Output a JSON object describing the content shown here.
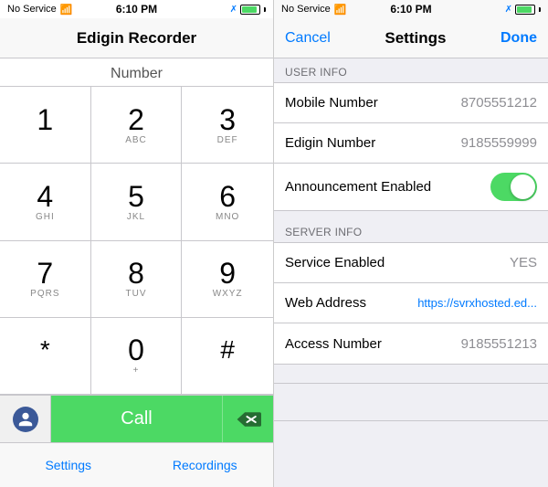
{
  "left": {
    "statusBar": {
      "noService": "No Service",
      "wifi": "WiFi",
      "time": "6:10 PM",
      "bluetooth": "BT",
      "battery": "Battery"
    },
    "title": "Edigin Recorder",
    "numberLabel": "Number",
    "dialerKeys": [
      {
        "digit": "1",
        "sub": ""
      },
      {
        "digit": "2",
        "sub": "ABC"
      },
      {
        "digit": "3",
        "sub": "DEF"
      },
      {
        "digit": "4",
        "sub": "GHI"
      },
      {
        "digit": "5",
        "sub": "JKL"
      },
      {
        "digit": "6",
        "sub": "MNO"
      },
      {
        "digit": "7",
        "sub": "PQRS"
      },
      {
        "digit": "8",
        "sub": "TUV"
      },
      {
        "digit": "9",
        "sub": "WXYZ"
      },
      {
        "digit": "*",
        "sub": ""
      },
      {
        "digit": "0",
        "sub": "+"
      },
      {
        "digit": "#",
        "sub": ""
      }
    ],
    "callLabel": "Call",
    "tabs": [
      {
        "label": "Settings"
      },
      {
        "label": "Recordings"
      }
    ]
  },
  "right": {
    "statusBar": {
      "noService": "No Service",
      "wifi": "WiFi",
      "time": "6:10 PM",
      "bluetooth": "BT",
      "battery": "Battery"
    },
    "nav": {
      "cancel": "Cancel",
      "title": "Settings",
      "done": "Done"
    },
    "sections": [
      {
        "header": "USER INFO",
        "rows": [
          {
            "label": "Mobile Number",
            "value": "8705551212",
            "type": "text"
          },
          {
            "label": "Edigin Number",
            "value": "9185559999",
            "type": "text"
          },
          {
            "label": "Announcement Enabled",
            "value": "",
            "type": "toggle",
            "toggled": true
          }
        ]
      },
      {
        "header": "SERVER INFO",
        "rows": [
          {
            "label": "Service Enabled",
            "value": "YES",
            "type": "text"
          },
          {
            "label": "Web Address",
            "value": "https://svrxhosted.ed...",
            "type": "link"
          },
          {
            "label": "Access Number",
            "value": "9185551213",
            "type": "text"
          }
        ]
      }
    ]
  }
}
